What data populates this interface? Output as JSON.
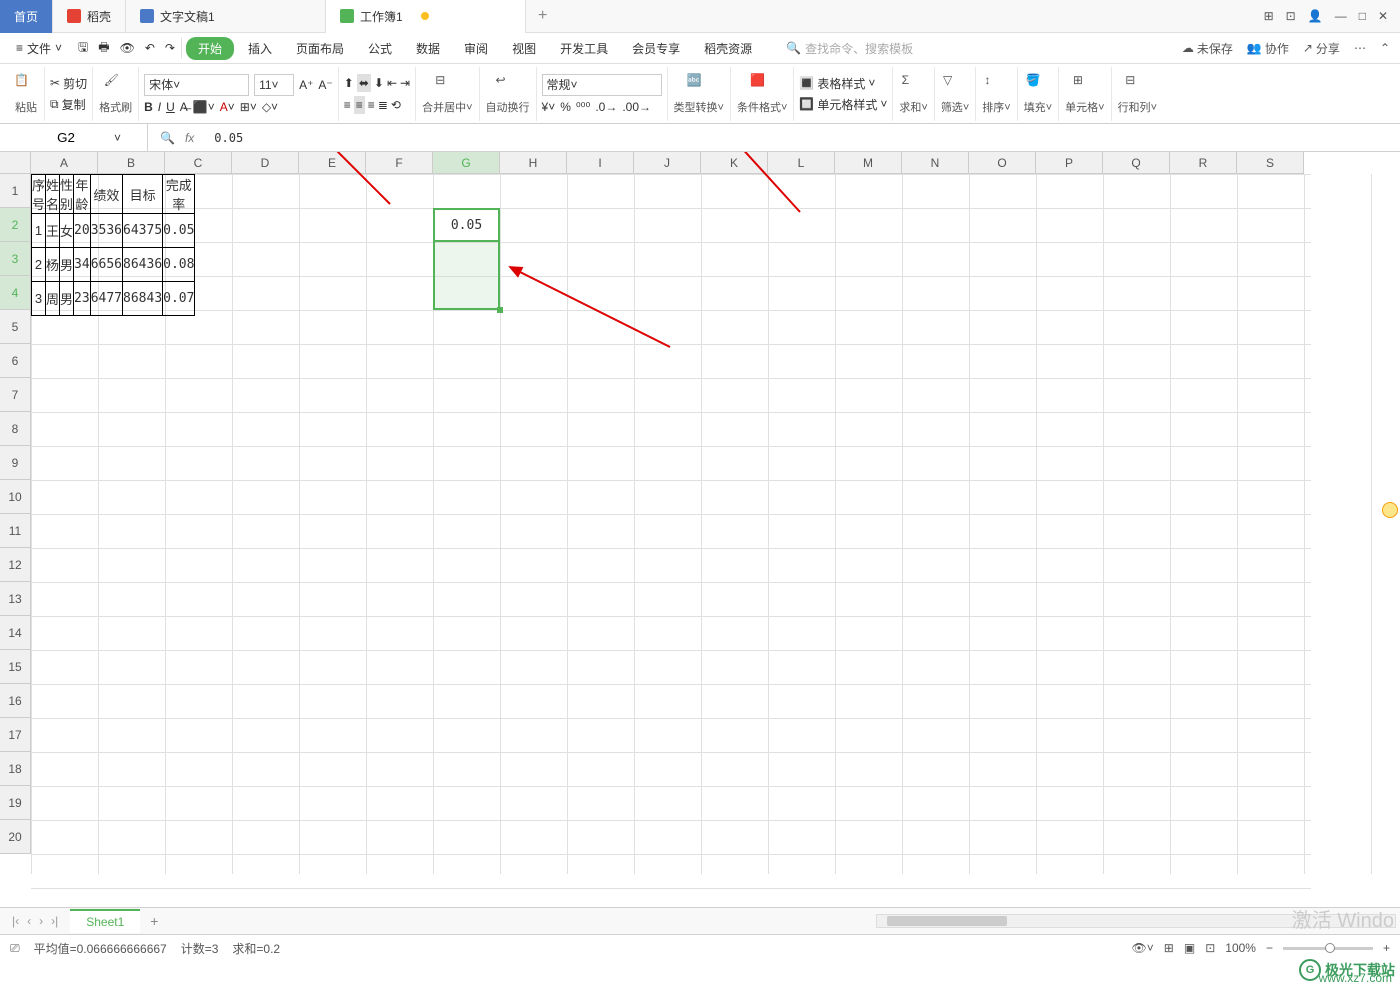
{
  "tabs": {
    "home": "首页",
    "daoke": "稻壳",
    "doc1": "文字文稿1",
    "book1": "工作簿1"
  },
  "menu": {
    "file": "文件",
    "start": "开始",
    "insert": "插入",
    "layout": "页面布局",
    "formula": "公式",
    "data": "数据",
    "review": "审阅",
    "view": "视图",
    "dev": "开发工具",
    "member": "会员专享",
    "daoke_res": "稻壳资源",
    "search_ph": "查找命令、搜索模板"
  },
  "collab": {
    "unsaved": "未保存",
    "coop": "协作",
    "share": "分享"
  },
  "ribbon": {
    "paste": "粘贴",
    "cut": "剪切",
    "copy": "复制",
    "format_painter": "格式刷",
    "font": "宋体",
    "fontsize": "11",
    "merge": "合并居中",
    "wrap": "自动换行",
    "numfmt": "常规",
    "type_convert": "类型转换",
    "cond_fmt": "条件格式",
    "table_style": "表格样式",
    "cell_style": "单元格样式",
    "sum": "求和",
    "filter": "筛选",
    "sort": "排序",
    "fill": "填充",
    "cell": "单元格",
    "rowcol": "行和列"
  },
  "namebox": "G2",
  "formula": "0.05",
  "columns": [
    "A",
    "B",
    "C",
    "D",
    "E",
    "F",
    "G",
    "H",
    "I",
    "J",
    "K",
    "L",
    "M",
    "N",
    "O",
    "P",
    "Q",
    "R",
    "S"
  ],
  "table": {
    "headers": [
      "序号",
      "姓名",
      "性别",
      "年龄",
      "绩效",
      "目标",
      "完成率"
    ],
    "rows": [
      [
        "1",
        "王",
        "女",
        "20",
        "3536",
        "64375",
        "0.05"
      ],
      [
        "2",
        "杨",
        "男",
        "34",
        "6656",
        "86436",
        "0.08"
      ],
      [
        "3",
        "周",
        "男",
        "23",
        "6477",
        "86843",
        "0.07"
      ]
    ]
  },
  "sheets": {
    "sheet1": "Sheet1"
  },
  "status": {
    "avg": "平均值=0.066666666667",
    "count": "计数=3",
    "sum": "求和=0.2",
    "zoom": "100%"
  },
  "watermark": {
    "activate": "激活 Windo",
    "url": "www.xz7.com",
    "brand": "极光下载站"
  }
}
